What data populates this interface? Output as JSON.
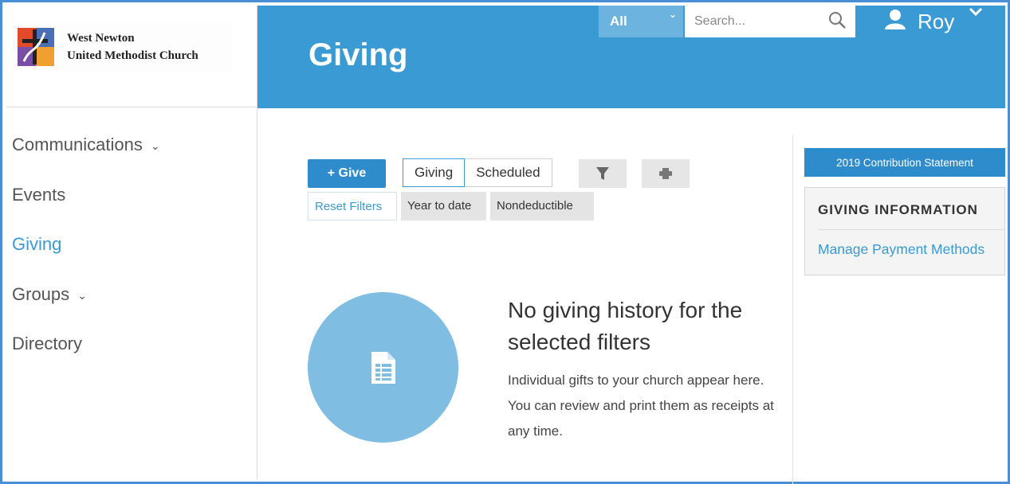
{
  "church": {
    "name_line1": "West Newton",
    "name_line2": "United Methodist Church"
  },
  "sidebar": {
    "items": [
      {
        "label": "Communications",
        "has_dropdown": true
      },
      {
        "label": "Events",
        "has_dropdown": false
      },
      {
        "label": "Giving",
        "has_dropdown": false,
        "active": true
      },
      {
        "label": "Groups",
        "has_dropdown": true
      },
      {
        "label": "Directory",
        "has_dropdown": false
      }
    ]
  },
  "header": {
    "title": "Giving",
    "scope": "All",
    "search_placeholder": "Search...",
    "user_name": "Roy",
    "color": "#3a9ad3"
  },
  "toolbar": {
    "give_label": "+ Give",
    "seg_giving": "Giving",
    "seg_scheduled": "Scheduled",
    "filter_icon": "funnel-icon",
    "print_icon": "printer-icon"
  },
  "filters": {
    "reset": "Reset Filters",
    "chip1": "Year to date",
    "chip2": "Nondeductible"
  },
  "empty_state": {
    "icon": "spreadsheet-icon",
    "title": "No giving history for the selected filters",
    "description": "Individual gifts to your church appear here. You can review and print them as receipts at any time."
  },
  "right_panel": {
    "statement_button": "2019 Contribution Statement",
    "info_heading": "GIVING INFORMATION",
    "manage_link": "Manage Payment Methods"
  }
}
